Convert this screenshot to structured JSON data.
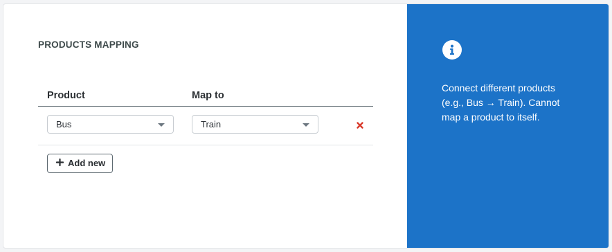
{
  "mapping": {
    "title": "PRODUCTS MAPPING",
    "columns": {
      "product": "Product",
      "map_to": "Map to"
    },
    "rows": [
      {
        "product": "Bus",
        "map_to": "Train",
        "remove_icon": "close-x-icon"
      }
    ],
    "add_button": {
      "icon": "plus-icon",
      "label": "Add new"
    }
  },
  "info": {
    "icon": "info-circle-icon",
    "text": "Connect different products (e.g., Bus → Train). Cannot map a product to itself."
  },
  "colors": {
    "info_panel_bg": "#1c73c8",
    "remove_icon": "#d93a2b",
    "title_text": "#3e4a4b"
  }
}
